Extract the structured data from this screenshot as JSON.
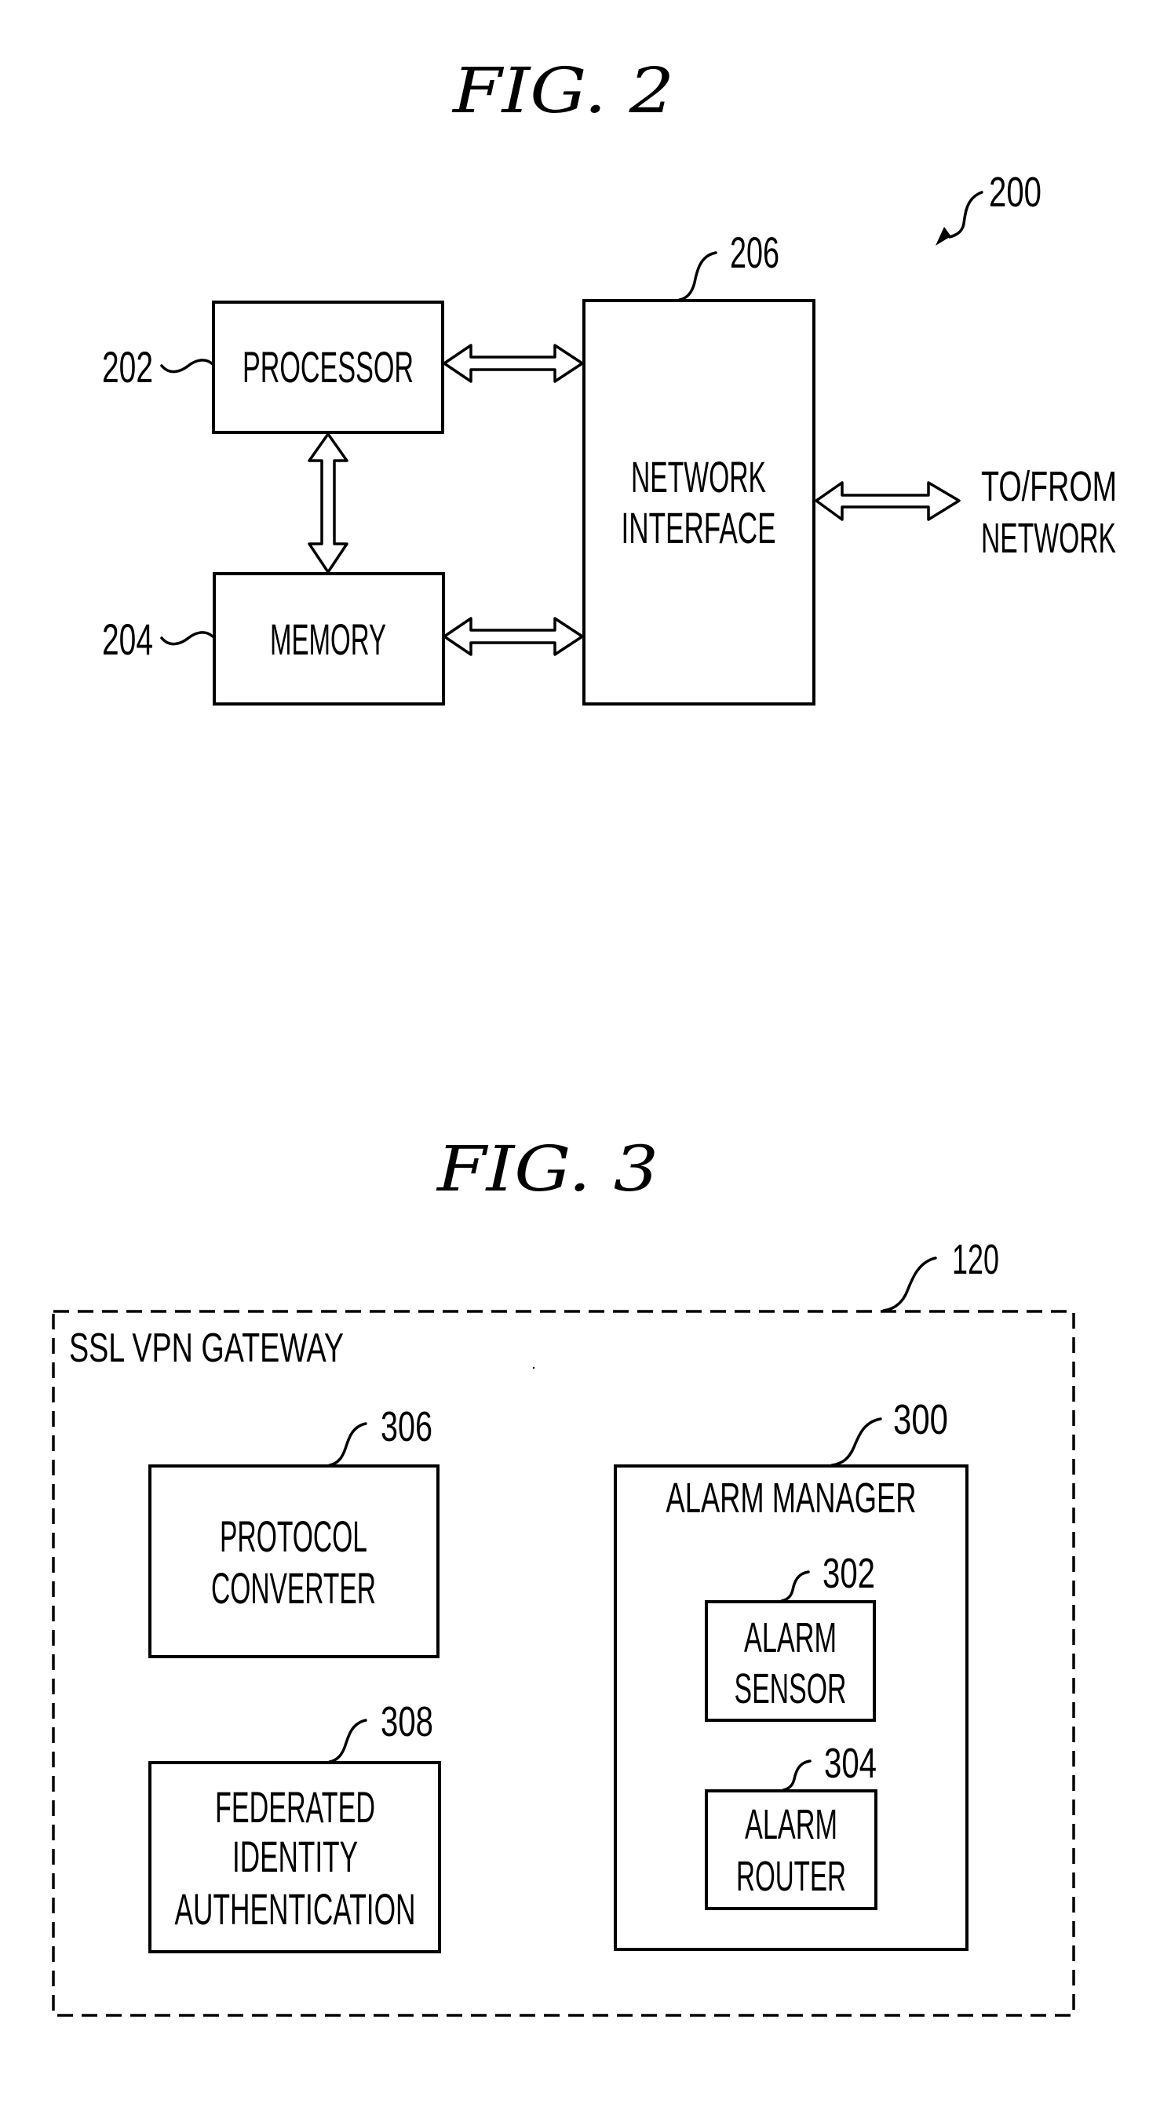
{
  "figures": [
    {
      "id": "fig2",
      "title": "FIG. 2",
      "system_ref": "200",
      "blocks": {
        "processor": {
          "ref": "202",
          "lines": [
            "PROCESSOR"
          ]
        },
        "memory": {
          "ref": "204",
          "lines": [
            "MEMORY"
          ]
        },
        "network_interface": {
          "ref": "206",
          "lines": [
            "NETWORK",
            "INTERFACE"
          ]
        }
      },
      "external": {
        "lines": [
          "TO/FROM",
          "NETWORK"
        ]
      },
      "connections": [
        {
          "from": "processor",
          "to": "network_interface",
          "type": "bidirectional"
        },
        {
          "from": "memory",
          "to": "network_interface",
          "type": "bidirectional"
        },
        {
          "from": "processor",
          "to": "memory",
          "type": "bidirectional"
        },
        {
          "from": "network_interface",
          "to": "external",
          "type": "bidirectional"
        }
      ]
    },
    {
      "id": "fig3",
      "title": "FIG. 3",
      "container": {
        "ref": "120",
        "label": "SSL VPN GATEWAY",
        "style": "dashed"
      },
      "blocks": {
        "protocol_converter": {
          "ref": "306",
          "lines": [
            "PROTOCOL",
            "CONVERTER"
          ]
        },
        "federated_identity": {
          "ref": "308",
          "lines": [
            "FEDERATED",
            "IDENTITY",
            "AUTHENTICATION"
          ]
        },
        "alarm_manager": {
          "ref": "300",
          "label": "ALARM MANAGER"
        },
        "alarm_sensor": {
          "ref": "302",
          "lines": [
            "ALARM",
            "SENSOR"
          ]
        },
        "alarm_router": {
          "ref": "304",
          "lines": [
            "ALARM",
            "ROUTER"
          ]
        }
      }
    }
  ]
}
